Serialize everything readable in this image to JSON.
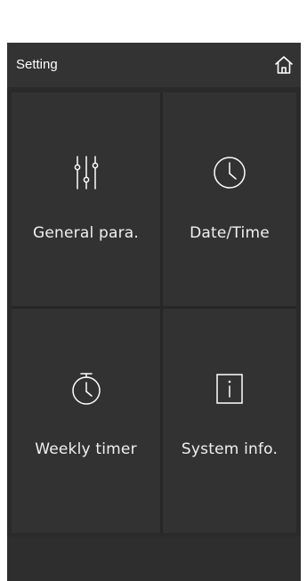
{
  "header": {
    "title": "Setting",
    "home_icon": "home-icon"
  },
  "tiles": [
    {
      "label": "General para.",
      "icon": "sliders-icon"
    },
    {
      "label": "Date/Time",
      "icon": "clock-icon"
    },
    {
      "label": "Weekly timer",
      "icon": "stopwatch-icon"
    },
    {
      "label": "System info.",
      "icon": "info-icon"
    }
  ],
  "colors": {
    "background": "#2a2a2a",
    "header": "#333333",
    "tile": "#323232",
    "text": "#f0f0f0",
    "icon": "#ffffff"
  }
}
